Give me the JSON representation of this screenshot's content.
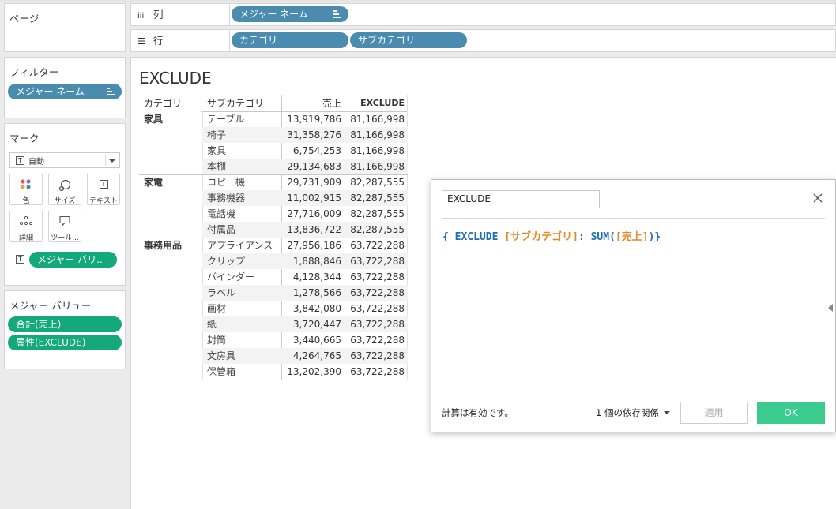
{
  "pages_card": {
    "title": "ページ"
  },
  "filters_card": {
    "title": "フィルター",
    "pill": "メジャー ネーム"
  },
  "marks_card": {
    "title": "マーク",
    "mark_type": "自動",
    "buttons": [
      {
        "label": "色",
        "icon": "color-dots-icon"
      },
      {
        "label": "サイズ",
        "icon": "size-icon"
      },
      {
        "label": "テキスト",
        "icon": "text-icon"
      },
      {
        "label": "詳細",
        "icon": "detail-icon"
      },
      {
        "label": "ツール...",
        "icon": "tooltip-icon"
      }
    ],
    "field_pill": "メジャー バリ.."
  },
  "measure_values_card": {
    "title": "メジャー バリュー",
    "pills": [
      "合計(売上)",
      "属性(EXCLUDE)"
    ]
  },
  "shelves": {
    "columns_label": "列",
    "columns_pill": "メジャー ネーム",
    "rows_label": "行",
    "rows_pills": [
      "カテゴリ",
      "サブカテゴリ"
    ]
  },
  "view": {
    "title": "EXCLUDE",
    "headers": [
      "カテゴリ",
      "サブカテゴリ",
      "売上",
      "EXCLUDE"
    ],
    "rows": [
      {
        "cat": "家具",
        "sub": "テーブル",
        "sales": "13,919,786",
        "exclude": "81,166,998"
      },
      {
        "cat": "",
        "sub": "椅子",
        "sales": "31,358,276",
        "exclude": "81,166,998"
      },
      {
        "cat": "",
        "sub": "家具",
        "sales": "6,754,253",
        "exclude": "81,166,998"
      },
      {
        "cat": "",
        "sub": "本棚",
        "sales": "29,134,683",
        "exclude": "81,166,998"
      },
      {
        "cat": "家電",
        "sub": "コピー機",
        "sales": "29,731,909",
        "exclude": "82,287,555"
      },
      {
        "cat": "",
        "sub": "事務機器",
        "sales": "11,002,915",
        "exclude": "82,287,555"
      },
      {
        "cat": "",
        "sub": "電話機",
        "sales": "27,716,009",
        "exclude": "82,287,555"
      },
      {
        "cat": "",
        "sub": "付属品",
        "sales": "13,836,722",
        "exclude": "82,287,555"
      },
      {
        "cat": "事務用品",
        "sub": "アプライアンス",
        "sales": "27,956,186",
        "exclude": "63,722,288"
      },
      {
        "cat": "",
        "sub": "クリップ",
        "sales": "1,888,846",
        "exclude": "63,722,288"
      },
      {
        "cat": "",
        "sub": "バインダー",
        "sales": "4,128,344",
        "exclude": "63,722,288"
      },
      {
        "cat": "",
        "sub": "ラベル",
        "sales": "1,278,566",
        "exclude": "63,722,288"
      },
      {
        "cat": "",
        "sub": "画材",
        "sales": "3,842,080",
        "exclude": "63,722,288"
      },
      {
        "cat": "",
        "sub": "紙",
        "sales": "3,720,447",
        "exclude": "63,722,288"
      },
      {
        "cat": "",
        "sub": "封筒",
        "sales": "3,440,665",
        "exclude": "63,722,288"
      },
      {
        "cat": "",
        "sub": "文房具",
        "sales": "4,264,765",
        "exclude": "63,722,288"
      },
      {
        "cat": "",
        "sub": "保管箱",
        "sales": "13,202,390",
        "exclude": "63,722,288"
      }
    ]
  },
  "calc_dialog": {
    "name": "EXCLUDE",
    "formula": {
      "open": "{ EXCLUDE ",
      "field1": "[サブカテゴリ]",
      "mid": ": SUM(",
      "field2": "[売上]",
      "close": ")}"
    },
    "status": "計算は有効です。",
    "dependencies": "1 個の依存関係",
    "apply_label": "適用",
    "ok_label": "OK"
  },
  "colors": {
    "dimension_pill": "#4a8cb0",
    "measure_pill": "#14a97a",
    "ok_button": "#3ccb8f",
    "formula_keyword": "#1f6fb2",
    "formula_field": "#e08a2a"
  }
}
